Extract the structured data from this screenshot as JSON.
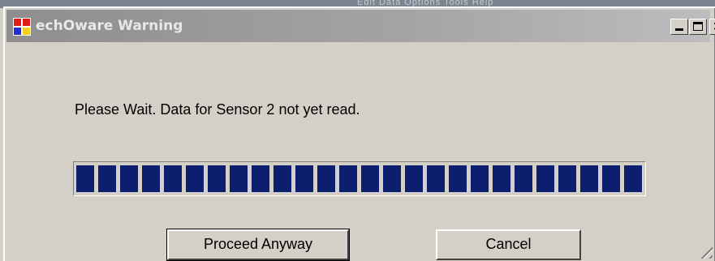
{
  "window": {
    "title": "echOware Warning",
    "icon": "app-icon"
  },
  "titlebar_buttons": {
    "minimize": "minimize-icon",
    "maximize": "maximize-icon",
    "close": "×"
  },
  "background_strip": {
    "text": "Edit   Data   Options   Tools   Help"
  },
  "message": "Please Wait.  Data for Sensor 2 not yet read.",
  "progress": {
    "fraction": 1.0,
    "bar_color": "#0b1f6e"
  },
  "buttons": {
    "proceed_label": "Proceed Anyway",
    "cancel_label": "Cancel"
  },
  "colors": {
    "titlebar_inactive": "#8e8e8e",
    "face": "#d4d0c8",
    "progress_block": "#0b1f6e"
  }
}
